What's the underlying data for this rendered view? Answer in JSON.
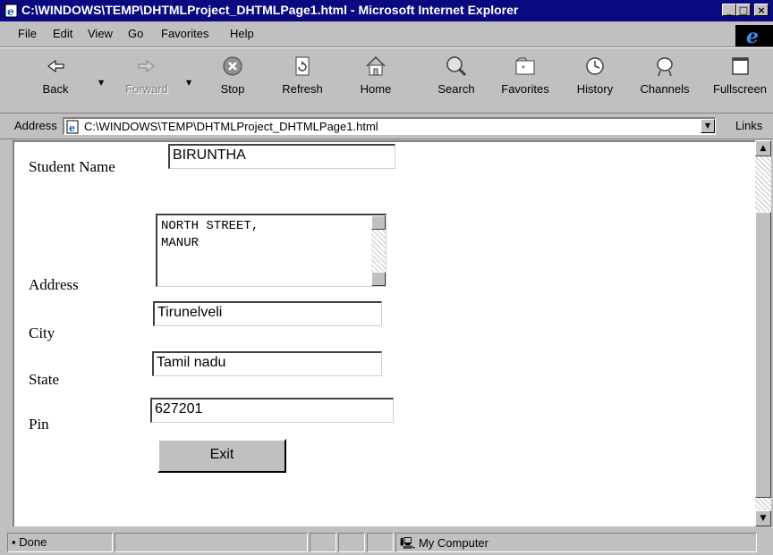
{
  "window": {
    "title": "C:\\WINDOWS\\TEMP\\DHTMLProject_DHTMLPage1.html - Microsoft Internet Explorer",
    "minimize_label": "_",
    "maximize_label": "□",
    "close_label": "×"
  },
  "menu": {
    "items": [
      "File",
      "Edit",
      "View",
      "Go",
      "Favorites",
      "Help"
    ]
  },
  "toolbar": {
    "buttons": [
      {
        "label": "Back",
        "icon": "back-arrow-icon"
      },
      {
        "label": "Forward",
        "icon": "forward-arrow-icon"
      },
      {
        "label": "Stop",
        "icon": "stop-icon"
      },
      {
        "label": "Refresh",
        "icon": "refresh-icon"
      },
      {
        "label": "Home",
        "icon": "home-icon"
      },
      {
        "label": "Search",
        "icon": "search-icon"
      },
      {
        "label": "Favorites",
        "icon": "favorites-icon"
      },
      {
        "label": "History",
        "icon": "history-icon"
      },
      {
        "label": "Channels",
        "icon": "channels-icon"
      },
      {
        "label": "Fullscreen",
        "icon": "fullscreen-icon"
      }
    ]
  },
  "address": {
    "label": "Address",
    "value": "C:\\WINDOWS\\TEMP\\DHTMLProject_DHTMLPage1.html",
    "links_label": "Links"
  },
  "form": {
    "student_name_label": "Student Name",
    "student_name_value": "BIRUNTHA",
    "address_label": "Address",
    "address_lines": [
      "NORTH STREET,",
      "MANUR"
    ],
    "city_label": "City",
    "city_value": "Tirunelveli",
    "state_label": "State",
    "state_value": "Tamil nadu",
    "pin_label": "Pin",
    "pin_value": "627201",
    "exit_label": "Exit"
  },
  "status": {
    "text": "Done",
    "zone": "My Computer"
  },
  "colors": {
    "title_bar": "#0a0a80",
    "chrome": "#c0c0c0"
  }
}
